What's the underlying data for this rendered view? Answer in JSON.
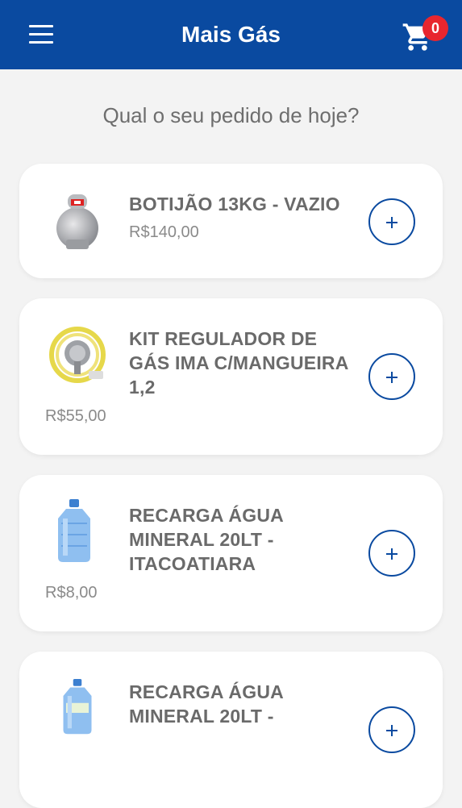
{
  "header": {
    "title": "Mais Gás",
    "cart_count": "0",
    "menu_icon": "menu-icon",
    "cart_icon": "cart-icon"
  },
  "subtitle": "Qual o seu pedido de hoje?",
  "colors": {
    "primary": "#0a4aa0",
    "badge": "#e8262e",
    "background": "#f3f3f3"
  },
  "products": [
    {
      "name": "BOTIJÃO 13KG - VAZIO",
      "price": "R$140,00",
      "image": "gas-cylinder-icon"
    },
    {
      "name": "KIT REGULADOR DE GÁS IMA C/MANGUEIRA 1,2",
      "price": "R$55,00",
      "image": "regulator-kit-icon"
    },
    {
      "name": "RECARGA ÁGUA MINERAL 20LT - ITACOATIARA",
      "price": "R$8,00",
      "image": "water-jug-icon"
    },
    {
      "name": "RECARGA ÁGUA MINERAL 20LT -",
      "price": "",
      "image": "water-jug-icon"
    }
  ]
}
